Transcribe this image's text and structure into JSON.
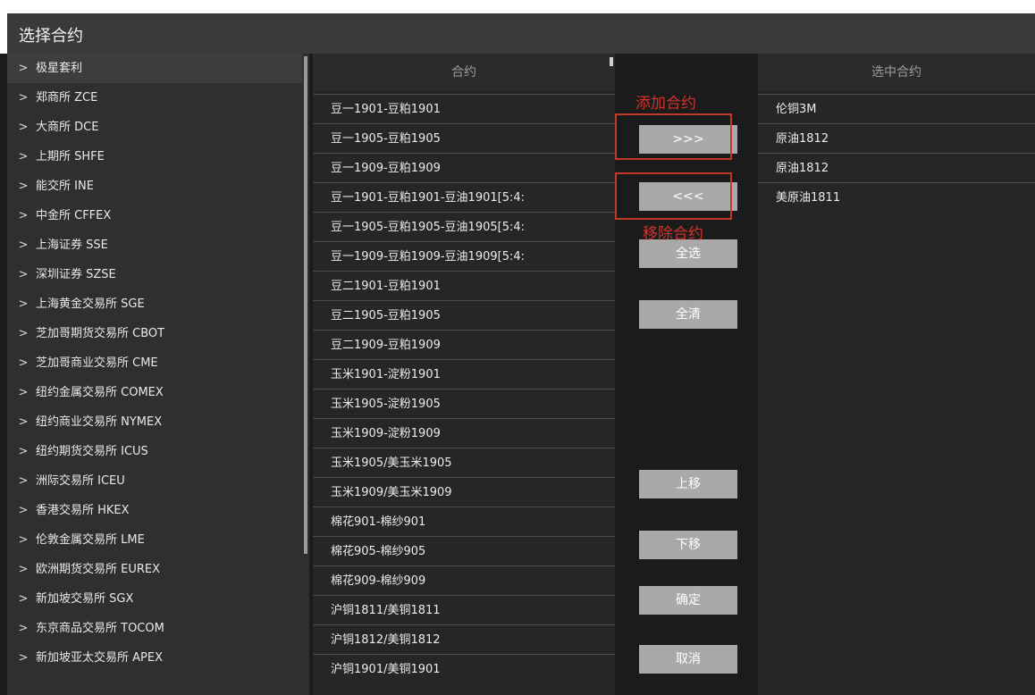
{
  "window": {
    "title": "选择合约"
  },
  "exchanges": [
    "极星套利",
    "郑商所 ZCE",
    "大商所 DCE",
    "上期所 SHFE",
    "能交所 INE",
    "中金所 CFFEX",
    "上海证券 SSE",
    "深圳证券 SZSE",
    "上海黄金交易所 SGE",
    "芝加哥期货交易所 CBOT",
    "芝加哥商业交易所 CME",
    "纽约金属交易所 COMEX",
    "纽约商业交易所 NYMEX",
    "纽约期货交易所 ICUS",
    "洲际交易所 ICEU",
    "香港交易所 HKEX",
    "伦敦金属交易所 LME",
    "欧洲期货交易所 EUREX",
    "新加坡交易所 SGX",
    "东京商品交易所 TOCOM",
    "新加坡亚太交易所 APEX"
  ],
  "contracts": {
    "header": "合约",
    "items": [
      "豆一1901-豆粕1901",
      "豆一1905-豆粕1905",
      "豆一1909-豆粕1909",
      "豆一1901-豆粕1901-豆油1901[5:4:",
      "豆一1905-豆粕1905-豆油1905[5:4:",
      "豆一1909-豆粕1909-豆油1909[5:4:",
      "豆二1901-豆粕1901",
      "豆二1905-豆粕1905",
      "豆二1909-豆粕1909",
      "玉米1901-淀粉1901",
      "玉米1905-淀粉1905",
      "玉米1909-淀粉1909",
      "玉米1905/美玉米1905",
      "玉米1909/美玉米1909",
      "棉花901-棉纱901",
      "棉花905-棉纱905",
      "棉花909-棉纱909",
      "沪铜1811/美铜1811",
      "沪铜1812/美铜1812",
      "沪铜1901/美铜1901"
    ]
  },
  "selected": {
    "header": "选中合约",
    "items": [
      "伦铜3M",
      "原油1812",
      "原油1812",
      "美原油1811"
    ]
  },
  "buttons": {
    "add": ">>>",
    "remove": "<<<",
    "select_all": "全选",
    "clear_all": "全清",
    "move_up": "上移",
    "move_down": "下移",
    "confirm": "确定",
    "cancel": "取消"
  },
  "annotations": {
    "add": "添加合约",
    "remove": "移除合约"
  }
}
